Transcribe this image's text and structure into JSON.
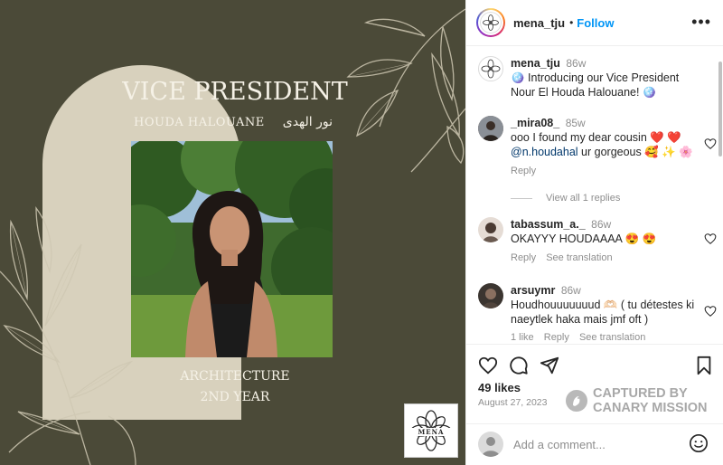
{
  "post": {
    "title": "VICE PRESIDENT",
    "name": "HOUDA HALOUANE",
    "name_arabic": "نور الهدى",
    "major": "ARCHITECTURE",
    "year": "2ND YEAR",
    "logo_text": "MENA"
  },
  "header": {
    "username": "mena_tju",
    "separator": "•",
    "follow_label": "Follow",
    "more_icon": "more-horizontal-icon"
  },
  "caption": {
    "username": "mena_tju",
    "time": "86w",
    "text": "🪩 Introducing our Vice President Nour El Houda Halouane! 🪩"
  },
  "comments": [
    {
      "username": "_mira08_",
      "time": "85w",
      "text_a": "ooo I found my dear cousin ❤️ ❤️",
      "mention": "@n.houdahal",
      "text_b": " ur gorgeous 🥰 ✨ 🌸",
      "reply_label": "Reply",
      "view_replies": "View all 1 replies"
    },
    {
      "username": "tabassum_a._",
      "time": "86w",
      "text": "OKAYYY HOUDAAAA 😍 😍",
      "reply_label": "Reply",
      "translate_label": "See translation"
    },
    {
      "username": "arsuymr",
      "time": "86w",
      "text": "Houdhouuuuuuud 🫶🏻 ( tu détestes ki naeytlek haka mais jmf oft )",
      "likes_label": "1 like",
      "reply_label": "Reply",
      "translate_label": "See translation"
    }
  ],
  "actions": {
    "likes": "49 likes",
    "date": "August 27, 2023",
    "watermark_line1": "CAPTURED BY",
    "watermark_line2": "CANARY MISSION"
  },
  "add_comment": {
    "placeholder": "Add a comment..."
  },
  "colors": {
    "post_background": "#4b4a38",
    "arch": "#d8d1bd",
    "link_blue": "#0095f6"
  }
}
